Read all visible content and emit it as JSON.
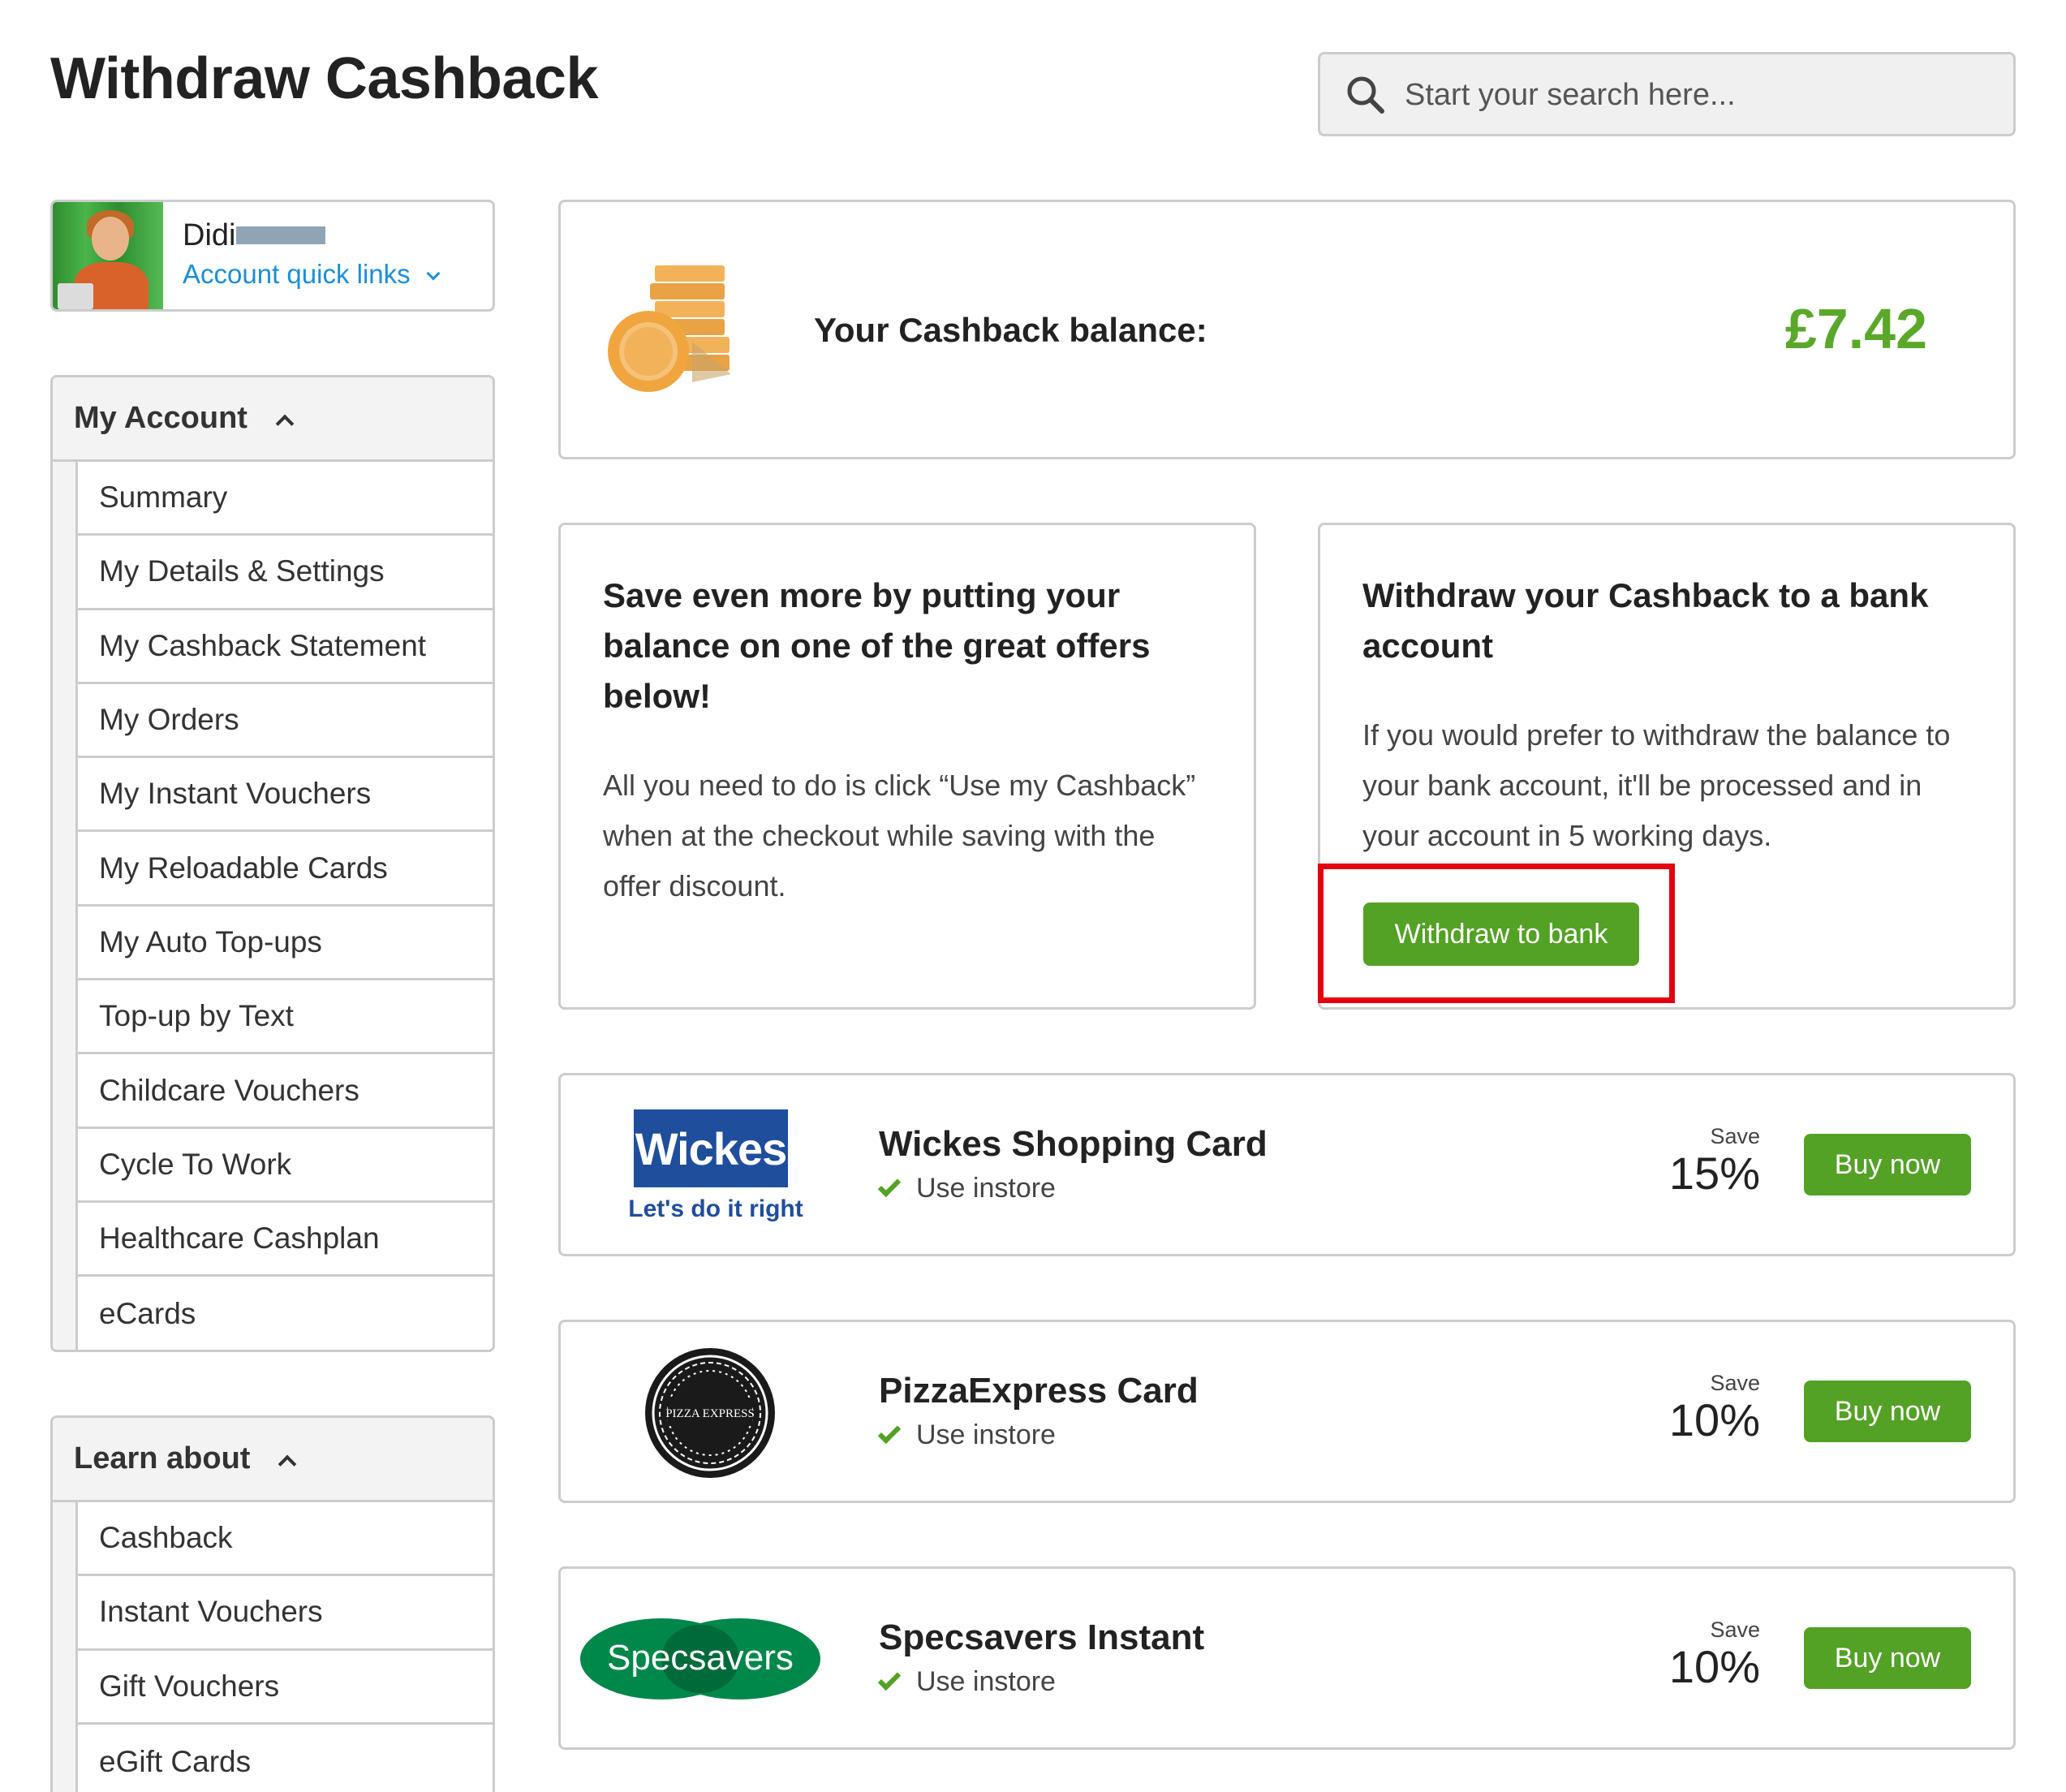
{
  "page": {
    "title": "Withdraw Cashback"
  },
  "search": {
    "placeholder": "Start your search here..."
  },
  "user": {
    "name": "Didi",
    "quick_links": "Account quick links"
  },
  "account_nav": {
    "heading": "My Account",
    "items": [
      {
        "label": "Summary"
      },
      {
        "label": "My Details & Settings"
      },
      {
        "label": "My Cashback Statement"
      },
      {
        "label": "My Orders"
      },
      {
        "label": "My Instant Vouchers"
      },
      {
        "label": "My Reloadable Cards"
      },
      {
        "label": "My Auto Top-ups"
      },
      {
        "label": "Top-up by Text"
      },
      {
        "label": "Childcare Vouchers"
      },
      {
        "label": "Cycle To Work"
      },
      {
        "label": "Healthcare Cashplan"
      },
      {
        "label": "eCards"
      }
    ]
  },
  "learn_nav": {
    "heading": "Learn about",
    "items": [
      {
        "label": "Cashback"
      },
      {
        "label": "Instant Vouchers"
      },
      {
        "label": "Gift Vouchers"
      },
      {
        "label": "eGift Cards"
      }
    ]
  },
  "balance": {
    "label": "Your Cashback balance:",
    "amount": "£7.42"
  },
  "offers_card": {
    "heading": "Save even more by putting your balance on one of the great offers below!",
    "body": "All you need to do is click “Use my Cashback” when at the checkout while saving with the offer discount."
  },
  "withdraw_card": {
    "heading": "Withdraw your Cashback to a bank account",
    "body": "If you would prefer to withdraw the balance to your bank account, it'll be processed and in your account in 5 working days.",
    "button": "Withdraw to bank"
  },
  "products": [
    {
      "name": "Wickes Shopping Card",
      "instore": "Use instore",
      "save_label": "Save",
      "save": "15%",
      "button": "Buy now",
      "logo": {
        "text": "Wickes",
        "tagline": "Let's do it right"
      }
    },
    {
      "name": "PizzaExpress Card",
      "instore": "Use instore",
      "save_label": "Save",
      "save": "10%",
      "button": "Buy now",
      "logo": {
        "text": "PIZZA EXPRESS"
      }
    },
    {
      "name": "Specsavers Instant",
      "instore": "Use instore",
      "save_label": "Save",
      "save": "10%",
      "button": "Buy now",
      "logo": {
        "text": "Specsavers"
      }
    }
  ],
  "colors": {
    "accent_green": "#53a125",
    "amount_green": "#5aa82a",
    "link_blue": "#1a8fd8",
    "highlight_red": "#e3000f"
  }
}
